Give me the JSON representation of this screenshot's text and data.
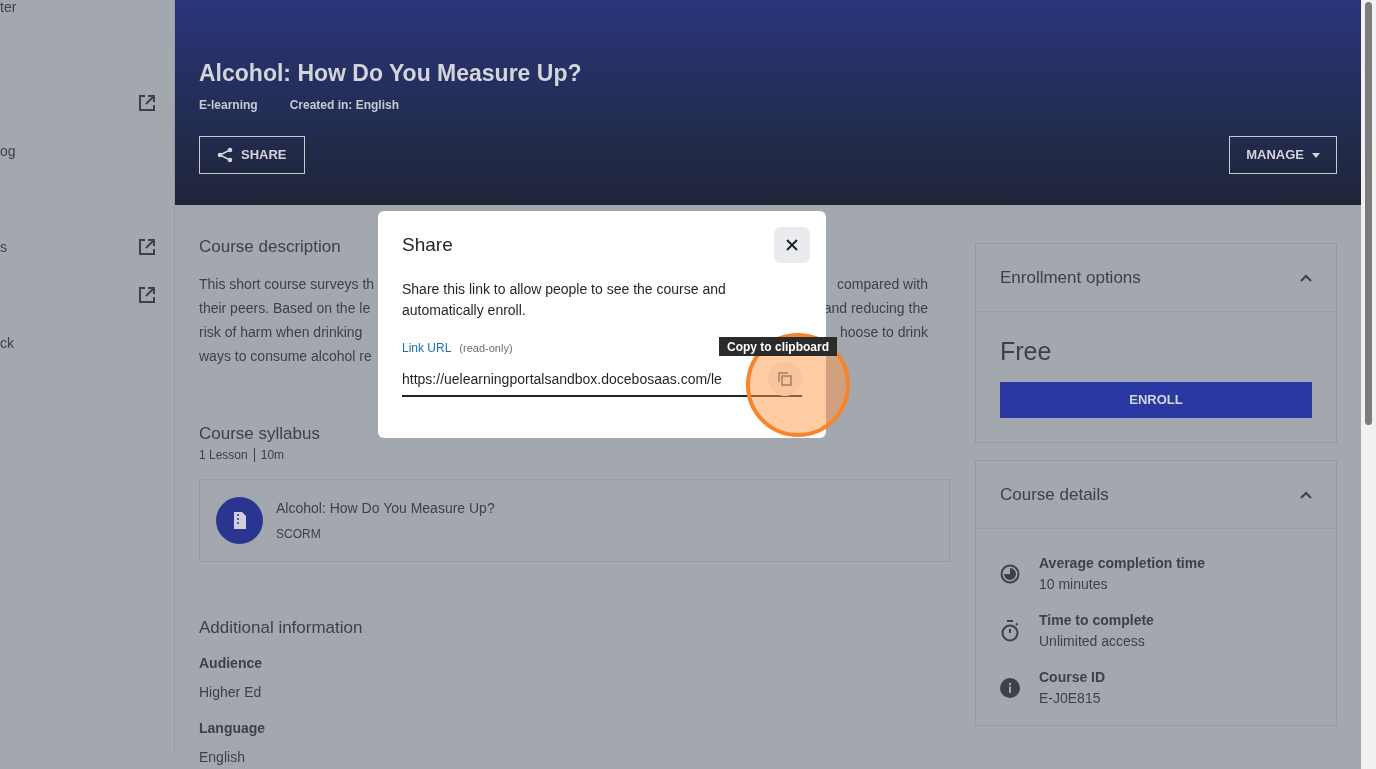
{
  "sidebar": {
    "groups": [
      [
        {
          "label": "ter",
          "external": false
        }
      ],
      [
        {
          "external": true
        },
        {
          "label": "og",
          "external": false
        }
      ],
      [
        {
          "label": "s",
          "external": true
        },
        {
          "external": true
        },
        {
          "label": "ck",
          "external": false
        }
      ]
    ]
  },
  "header": {
    "title": "Alcohol: How Do You Measure Up?",
    "meta": [
      {
        "label": "E-learning"
      },
      {
        "label": "Created in: English"
      }
    ],
    "share_button": "SHARE",
    "manage_button": "MANAGE"
  },
  "description": {
    "heading": "Course description",
    "lines": [
      {
        "left": "This short course surveys th",
        "right": "compared with"
      },
      {
        "left": "their peers. Based on the le",
        "right": "and reducing the"
      },
      {
        "left": "risk of harm when drinking",
        "right": "hoose to drink"
      },
      {
        "left": "ways to consume alcohol re"
      }
    ]
  },
  "syllabus": {
    "heading": "Course syllabus",
    "lessons_count": "1 Lesson",
    "duration": "10m",
    "lessons": [
      {
        "title": "Alcohol: How Do You Measure Up?",
        "type": "SCORM"
      }
    ]
  },
  "additional": {
    "heading": "Additional information",
    "fields": [
      {
        "label": "Audience",
        "value": "Higher Ed"
      },
      {
        "label": "Language",
        "value": "English"
      }
    ]
  },
  "enrollment": {
    "heading": "Enrollment options",
    "expanded": true,
    "price": "Free",
    "button": "ENROLL"
  },
  "details": {
    "heading": "Course details",
    "expanded": true,
    "items": [
      {
        "kind": "clock",
        "label": "Average completion time",
        "value": "10 minutes"
      },
      {
        "kind": "timer",
        "label": "Time to complete",
        "value": "Unlimited access"
      },
      {
        "kind": "info",
        "label": "Course ID",
        "value": "E-J0E815"
      }
    ]
  },
  "share_dialog": {
    "title": "Share",
    "message": "Share this link to allow people to see the course and automatically enroll.",
    "field_label": "Link URL",
    "field_note": "(read-only)",
    "url": "https://uelearningportalsandbox.docebosaas.com/le",
    "tooltip": "Copy to clipboard"
  }
}
